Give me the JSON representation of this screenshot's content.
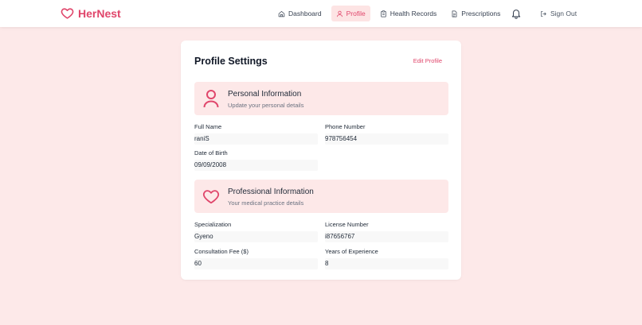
{
  "brand": {
    "name": "HerNest",
    "logo_icon": "heart-icon",
    "color": "#e0466b"
  },
  "nav": {
    "items": [
      {
        "label": "Dashboard",
        "icon": "home-icon",
        "active": false
      },
      {
        "label": "Profile",
        "icon": "user-icon",
        "active": true
      },
      {
        "label": "Health Records",
        "icon": "clipboard-icon",
        "active": false
      },
      {
        "label": "Prescriptions",
        "icon": "document-icon",
        "active": false
      }
    ],
    "notifications_icon": "bell-icon",
    "signout_label": "Sign Out"
  },
  "profile": {
    "title": "Profile Settings",
    "edit_label": "Edit Profile",
    "personal": {
      "title": "Personal Information",
      "subtitle": "Update your personal details",
      "fields": {
        "full_name": {
          "label": "Full Name",
          "value": "raniS"
        },
        "phone": {
          "label": "Phone Number",
          "value": "978756454"
        },
        "dob": {
          "label": "Date of Birth",
          "value": "09/09/2008"
        }
      }
    },
    "professional": {
      "title": "Professional Information",
      "subtitle": "Your medical practice details",
      "fields": {
        "specialization": {
          "label": "Specialization",
          "value": "Gyeno"
        },
        "license": {
          "label": "License Number",
          "value": "i87656767"
        },
        "fee": {
          "label": "Consultation Fee ($)",
          "value": "60"
        },
        "experience": {
          "label": "Years of Experience",
          "value": "8"
        }
      }
    }
  }
}
